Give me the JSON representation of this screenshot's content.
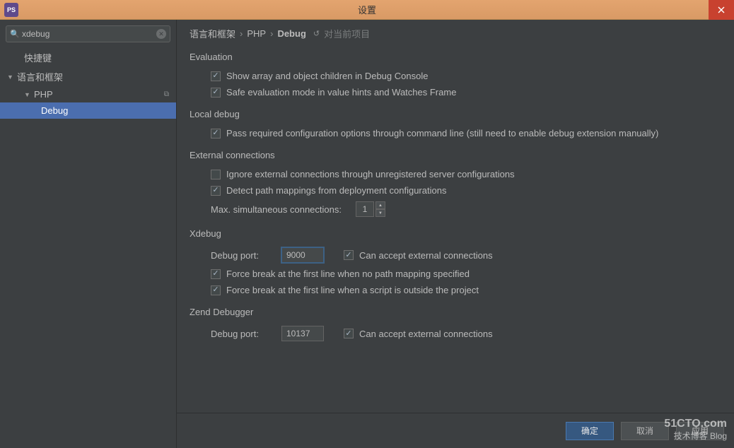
{
  "titlebar": {
    "title": "设置",
    "icon_text": "PS"
  },
  "search": {
    "value": "xdebug",
    "placeholder": ""
  },
  "tree": {
    "item0": "快捷键",
    "item1": "语言和框架",
    "item2": "PHP",
    "item3": "Debug"
  },
  "breadcrumb": {
    "p0": "语言和框架",
    "p1": "PHP",
    "p2": "Debug",
    "scope": "对当前项目"
  },
  "sections": {
    "evaluation": {
      "title": "Evaluation",
      "cb1": "Show array and object children in Debug Console",
      "cb2": "Safe evaluation mode in value hints and Watches Frame"
    },
    "localdebug": {
      "title": "Local debug",
      "cb1": "Pass required configuration options through command line (still need to enable debug extension manually)"
    },
    "external": {
      "title": "External connections",
      "cb1": "Ignore external connections through unregistered server configurations",
      "cb2": "Detect path mappings from deployment configurations",
      "maxconn_label": "Max. simultaneous connections:",
      "maxconn_value": "1"
    },
    "xdebug": {
      "title": "Xdebug",
      "port_label": "Debug port:",
      "port_value": "9000",
      "cb_accept": "Can accept external connections",
      "cb_force1": "Force break at the first line when no path mapping specified",
      "cb_force2": "Force break at the first line when a script is outside the project"
    },
    "zend": {
      "title": "Zend Debugger",
      "port_label": "Debug port:",
      "port_value": "10137",
      "cb_accept": "Can accept external connections"
    }
  },
  "footer": {
    "ok": "确定",
    "cancel": "取消",
    "apply": "应用"
  },
  "watermark": {
    "l1": "51CTO.com",
    "l2": "技术博客  Blog"
  }
}
